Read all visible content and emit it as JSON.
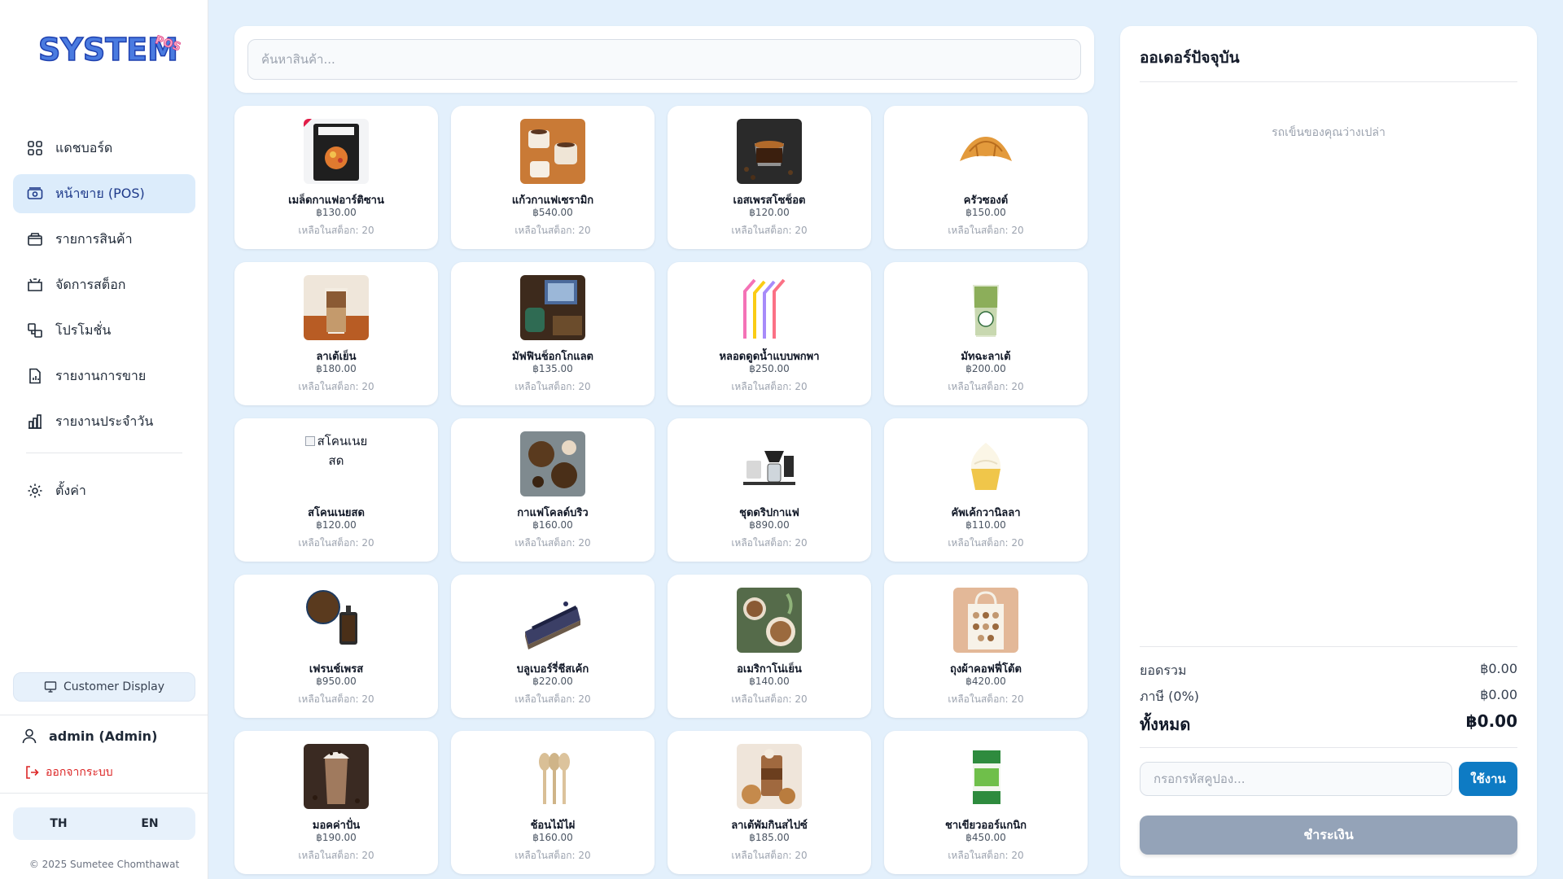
{
  "app": {
    "logo_text": "SYSTEM",
    "logo_sub": "POS"
  },
  "sidebar": {
    "items": [
      {
        "label": "แดชบอร์ด",
        "icon": "dashboard-grid-icon",
        "active": false
      },
      {
        "label": "หน้าขาย (POS)",
        "icon": "cash-register-icon",
        "active": true
      },
      {
        "label": "รายการสินค้า",
        "icon": "box-icon",
        "active": false
      },
      {
        "label": "จัดการสต็อก",
        "icon": "stock-box-icon",
        "active": false
      },
      {
        "label": "โปรโมชั่น",
        "icon": "promotion-icon",
        "active": false
      },
      {
        "label": "รายงานการขาย",
        "icon": "report-icon",
        "active": false
      },
      {
        "label": "รายงานประจำวัน",
        "icon": "bar-chart-icon",
        "active": false
      }
    ],
    "settings_label": "ตั้งค่า",
    "customer_display_label": "Customer Display",
    "user_name": "admin (Admin)",
    "logout_label": "ออกจากระบบ",
    "lang_th": "TH",
    "lang_en": "EN",
    "copyright": "© 2025 Sumetee Chomthawat"
  },
  "search": {
    "placeholder": "ค้นหาสินค้า..."
  },
  "products": [
    {
      "name": "เมล็ดกาแฟอาร์ติซาน",
      "price": "฿130.00",
      "stock": "เหลือในสต็อก: 20",
      "image": "coffee-bag"
    },
    {
      "name": "แก้วกาแฟเซรามิก",
      "price": "฿540.00",
      "stock": "เหลือในสต็อก: 20",
      "image": "ceramic-cups"
    },
    {
      "name": "เอสเพรสโซช็อต",
      "price": "฿120.00",
      "stock": "เหลือในสต็อก: 20",
      "image": "espresso"
    },
    {
      "name": "ครัวซองต์",
      "price": "฿150.00",
      "stock": "เหลือในสต็อก: 20",
      "image": "croissant"
    },
    {
      "name": "ลาเต้เย็น",
      "price": "฿180.00",
      "stock": "เหลือในสต็อก: 20",
      "image": "iced-latte"
    },
    {
      "name": "มัฟฟินช็อกโกแลต",
      "price": "฿135.00",
      "stock": "เหลือในสต็อก: 20",
      "image": "muffin"
    },
    {
      "name": "หลอดดูดน้ำแบบพกพา",
      "price": "฿250.00",
      "stock": "เหลือในสต็อก: 20",
      "image": "straws"
    },
    {
      "name": "มัทฉะลาเต้",
      "price": "฿200.00",
      "stock": "เหลือในสต็อก: 20",
      "image": "matcha"
    },
    {
      "name": "สโคนเนยสด",
      "price": "฿120.00",
      "stock": "เหลือในสต็อก: 20",
      "image": "broken",
      "alt": "สโคนเนยสด"
    },
    {
      "name": "กาแฟโคลด์บริว",
      "price": "฿160.00",
      "stock": "เหลือในสต็อก: 20",
      "image": "cold-brew"
    },
    {
      "name": "ชุดดริปกาแฟ",
      "price": "฿890.00",
      "stock": "เหลือในสต็อก: 20",
      "image": "drip-set"
    },
    {
      "name": "คัพเค้กวานิลลา",
      "price": "฿110.00",
      "stock": "เหลือในสต็อก: 20",
      "image": "cupcake"
    },
    {
      "name": "เฟรนช์เพรส",
      "price": "฿950.00",
      "stock": "เหลือในสต็อก: 20",
      "image": "french-press"
    },
    {
      "name": "บลูเบอร์รี่ชีสเค้ก",
      "price": "฿220.00",
      "stock": "เหลือในสต็อก: 20",
      "image": "cheesecake"
    },
    {
      "name": "อเมริกาโน่เย็น",
      "price": "฿140.00",
      "stock": "เหลือในสต็อก: 20",
      "image": "americano"
    },
    {
      "name": "ถุงผ้าคอฟฟี่โต้ต",
      "price": "฿420.00",
      "stock": "เหลือในสต็อก: 20",
      "image": "tote"
    },
    {
      "name": "มอคค่าปั่น",
      "price": "฿190.00",
      "stock": "เหลือในสต็อก: 20",
      "image": "mocha"
    },
    {
      "name": "ช้อนไม้ไผ่",
      "price": "฿160.00",
      "stock": "เหลือในสต็อก: 20",
      "image": "spoons"
    },
    {
      "name": "ลาเต้พัมกินสไปซ์",
      "price": "฿185.00",
      "stock": "เหลือในสต็อก: 20",
      "image": "pumpkin"
    },
    {
      "name": "ชาเขียวออร์แกนิก",
      "price": "฿450.00",
      "stock": "เหลือในสต็อก: 20",
      "image": "green-tea"
    }
  ],
  "order": {
    "title": "ออเดอร์ปัจจุบัน",
    "empty_text": "รถเข็นของคุณว่างเปล่า",
    "subtotal_label": "ยอดรวม",
    "subtotal_value": "฿0.00",
    "tax_label": "ภาษี (0%)",
    "tax_value": "฿0.00",
    "total_label": "ทั้งหมด",
    "total_value": "฿0.00",
    "coupon_placeholder": "กรอกรหัสคูปอง...",
    "apply_label": "ใช้งาน",
    "pay_label": "ชำระเงิน"
  },
  "colors": {
    "background": "#e3f0fc",
    "accent": "#0e7bc4",
    "active_nav": "#dcecfb",
    "logout": "#dc2626",
    "pay_disabled": "#94a3b8"
  }
}
